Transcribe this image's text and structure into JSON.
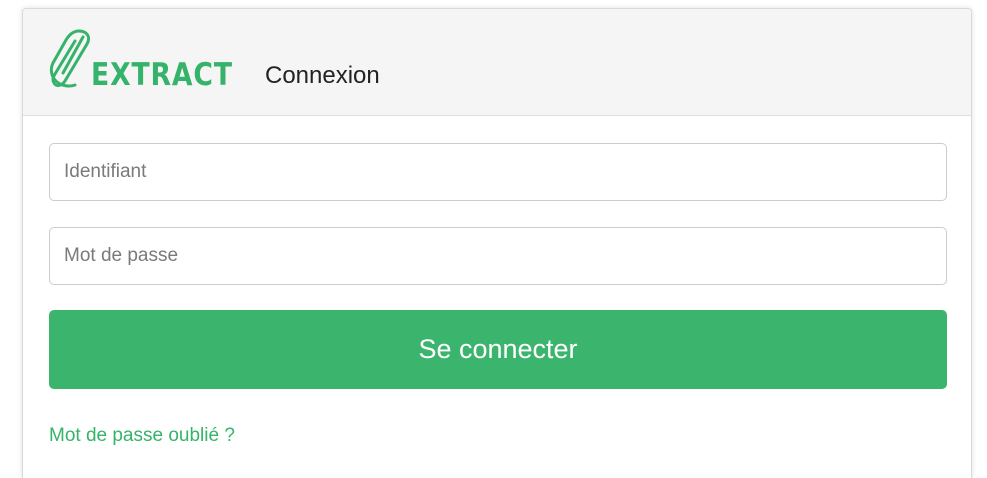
{
  "header": {
    "logo_text": "EXTRACT",
    "title": "Connexion"
  },
  "form": {
    "username_placeholder": "Identifiant",
    "password_placeholder": "Mot de passe",
    "submit_label": "Se connecter",
    "forgot_label": "Mot de passe oublié ?"
  },
  "colors": {
    "brand_green": "#3bb46e",
    "header_bg": "#f5f5f5"
  },
  "icons": {
    "logo": "paperclip-logo-icon"
  }
}
